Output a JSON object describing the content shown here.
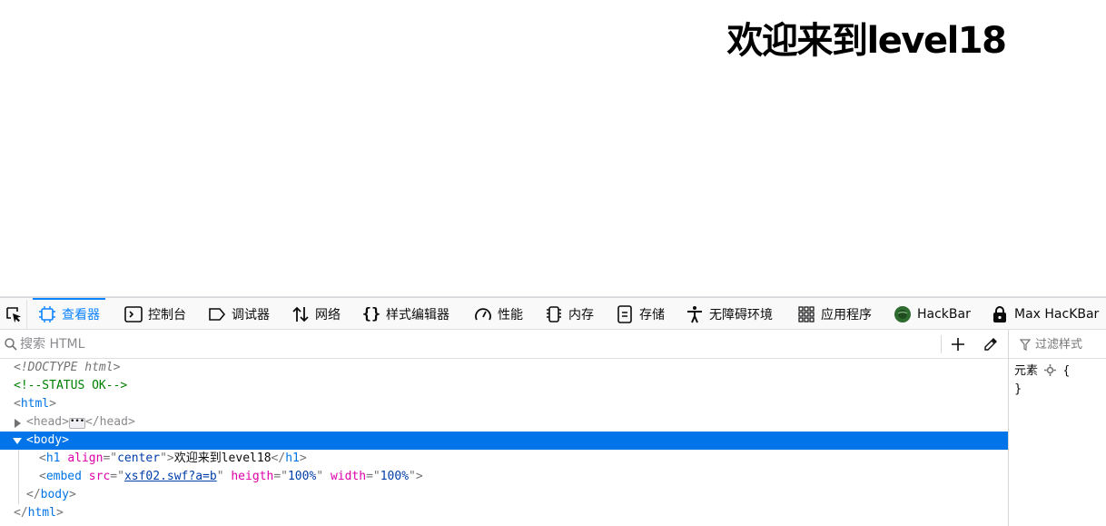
{
  "page": {
    "heading": "欢迎来到level18"
  },
  "toolbar": {
    "tabs": [
      {
        "label": "查看器",
        "icon": "inspector-icon"
      },
      {
        "label": "控制台",
        "icon": "console-icon"
      },
      {
        "label": "调试器",
        "icon": "debugger-icon"
      },
      {
        "label": "网络",
        "icon": "network-icon"
      },
      {
        "label": "样式编辑器",
        "icon": "style-editor-icon"
      },
      {
        "label": "性能",
        "icon": "performance-icon"
      },
      {
        "label": "内存",
        "icon": "memory-icon"
      },
      {
        "label": "存储",
        "icon": "storage-icon"
      },
      {
        "label": "无障碍环境",
        "icon": "accessibility-icon"
      },
      {
        "label": "应用程序",
        "icon": "application-icon"
      },
      {
        "label": "HackBar",
        "icon": "hackbar-icon"
      },
      {
        "label": "Max HacKBar",
        "icon": "max-hackbar-icon"
      }
    ],
    "accent_color": "#0a84ff"
  },
  "search": {
    "placeholder": "搜索 HTML"
  },
  "markup": {
    "doctype": "<!DOCTYPE html>",
    "comment": "<!--STATUS OK-->",
    "html_tag": "html",
    "head_tag": "head",
    "body_tag": "body",
    "h1_tag": "h1",
    "h1_attr_name": "align",
    "h1_attr_value": "center",
    "h1_text": "欢迎来到level18",
    "embed_tag": "embed",
    "embed_src_name": "src",
    "embed_src_value": "xsf02.swf?a=b",
    "embed_heigth_name": "heigth",
    "embed_heigth_value": "100%",
    "embed_width_name": "width",
    "embed_width_value": "100%",
    "selection_color": "#0074e8"
  },
  "rules": {
    "filter_placeholder": "过滤样式",
    "element_label": "元素",
    "open_brace": "{",
    "close_brace": "}"
  }
}
